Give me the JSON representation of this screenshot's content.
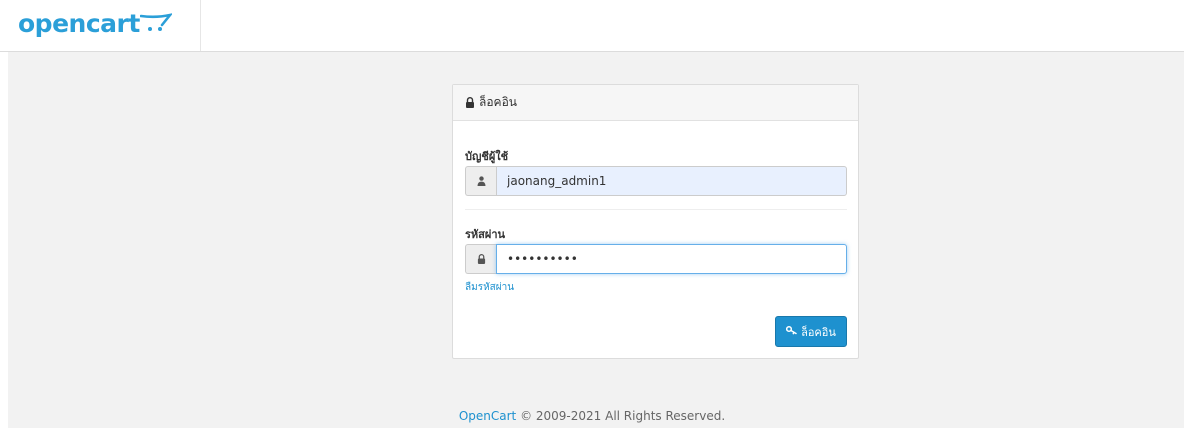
{
  "header": {
    "logo_text": "opencart"
  },
  "login_panel": {
    "title": "ล็อคอิน",
    "username_label": "บัญชีผู้ใช้",
    "username_value": "jaonang_admin1",
    "password_label": "รหัสผ่าน",
    "password_value": "••••••••••",
    "forgot_link": "ลืมรหัสผ่าน",
    "login_button": "ล็อคอิน"
  },
  "footer": {
    "brand_link": "OpenCart",
    "copyright": " © 2009-2021 All Rights Reserved."
  },
  "colors": {
    "brand": "#2b9fd8",
    "primary_button": "#1e91cf",
    "background": "#f2f2f2"
  },
  "icons": [
    "lock-icon",
    "user-icon",
    "key-icon",
    "cart-icon"
  ]
}
